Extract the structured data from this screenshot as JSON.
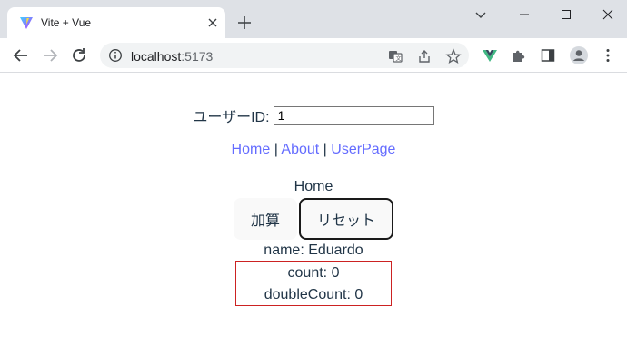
{
  "browser": {
    "tab": {
      "title": "Vite + Vue"
    },
    "address": {
      "host": "localhost",
      "port": ":5173"
    }
  },
  "page": {
    "userid": {
      "label": "ユーザーID:",
      "value": "1"
    },
    "nav": {
      "links": [
        "Home",
        "About",
        "UserPage"
      ],
      "separator": "|"
    },
    "view_title": "Home",
    "buttons": {
      "add": "加算",
      "reset": "リセット"
    },
    "name_line": "name: Eduardo",
    "count_line": "count: 0",
    "double_count_line": "doubleCount: 0"
  },
  "colors": {
    "link": "#646cff",
    "box_border": "#cc2222",
    "text": "#213547"
  }
}
